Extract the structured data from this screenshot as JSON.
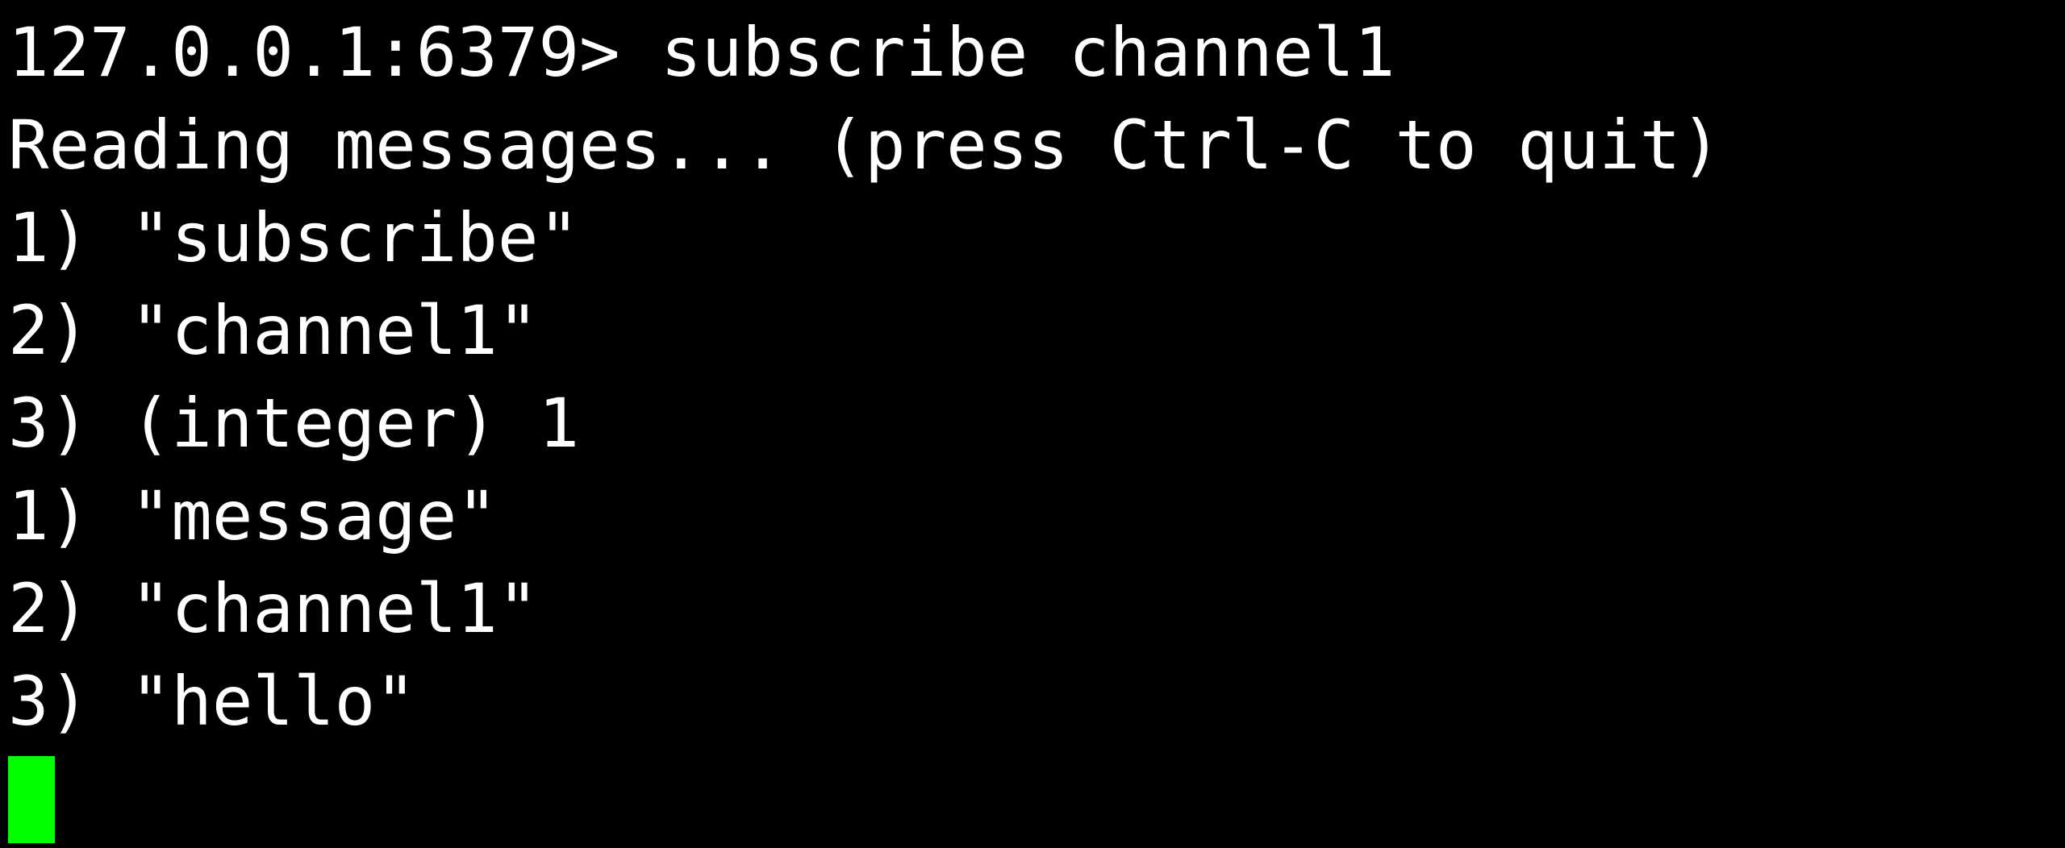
{
  "terminal": {
    "lines": [
      "127.0.0.1:6379> subscribe channel1",
      "Reading messages... (press Ctrl-C to quit)",
      "1) \"subscribe\"",
      "2) \"channel1\"",
      "3) (integer) 1",
      "1) \"message\"",
      "2) \"channel1\"",
      "3) \"hello\""
    ],
    "cursor_color": "#00ff00",
    "foreground_color": "#ffffff",
    "background_color": "#000000"
  }
}
